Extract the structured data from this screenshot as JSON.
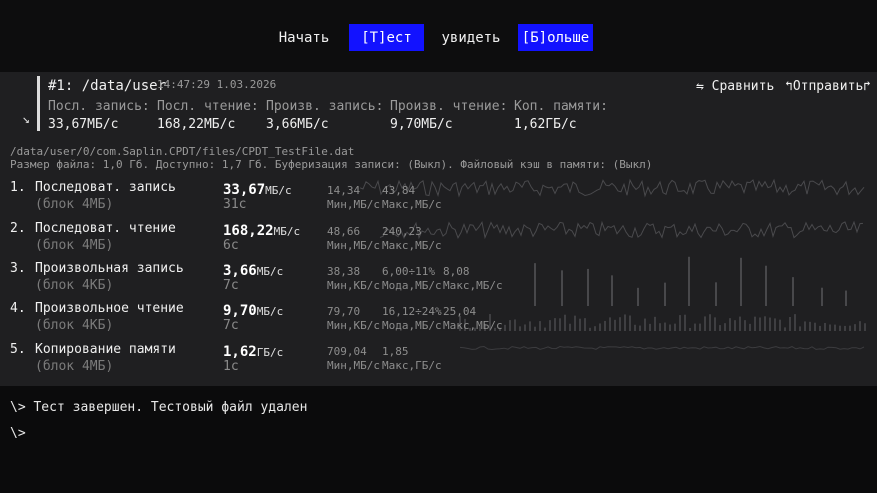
{
  "menu": {
    "start": "Начать",
    "test": "[Т]ест",
    "view": "увидеть",
    "more": "[Б]ольше"
  },
  "header": {
    "title": "#1: /data/user",
    "timestamp": "14:47:29 1.03.2026",
    "compare": "⇋ Сравнить",
    "send": "↰Отправить↱",
    "columns": [
      {
        "label": "Посл. запись:",
        "value": "33,67МБ/с"
      },
      {
        "label": "Посл. чтение:",
        "value": "168,22МБ/с"
      },
      {
        "label": "Произв. запись:",
        "value": "3,66МБ/с"
      },
      {
        "label": "Произв. чтение:",
        "value": "9,70МБ/с"
      },
      {
        "label": "Коп. памяти:",
        "value": "1,62ГБ/с"
      }
    ]
  },
  "file": {
    "path": "/data/user/0/com.Saplin.CPDT/files/CPDT_TestFile.dat",
    "info": "Размер файла: 1,0 Гб. Доступно: 1,7 Гб. Буферизация записи: (Выкл). Файловый кэш в памяти: (Выкл)"
  },
  "tests": [
    {
      "num": "1.",
      "name": "Последоват. запись",
      "block": "(блок 4МБ)",
      "value": "33,67",
      "unit": "МБ/с",
      "time": "31с",
      "stats": [
        {
          "v": "14,34",
          "l": "Мин,МБ/с"
        },
        {
          "v": "43,84",
          "l": "Макс,МБ/с"
        }
      ]
    },
    {
      "num": "2.",
      "name": "Последоват. чтение",
      "block": "(блок 4МБ)",
      "value": "168,22",
      "unit": "МБ/с",
      "time": "6с",
      "stats": [
        {
          "v": "48,66",
          "l": "Мин,МБ/с"
        },
        {
          "v": "240,23",
          "l": "Макс,МБ/с"
        }
      ]
    },
    {
      "num": "3.",
      "name": "Произвольная запись",
      "block": "(блок 4КБ)",
      "value": "3,66",
      "unit": "МБ/с",
      "time": "7с",
      "stats": [
        {
          "v": "38,38",
          "l": "Мин,КБ/с"
        },
        {
          "v": "6,00÷11%",
          "l": "Мода,МБ/с"
        },
        {
          "v": "8,08",
          "l": "Макс,МБ/с"
        }
      ]
    },
    {
      "num": "4.",
      "name": "Произвольное чтение",
      "block": "(блок 4КБ)",
      "value": "9,70",
      "unit": "МБ/с",
      "time": "7с",
      "stats": [
        {
          "v": "79,70",
          "l": "Мин,КБ/с"
        },
        {
          "v": "16,12÷24%",
          "l": "Мода,МБ/с"
        },
        {
          "v": "25,04",
          "l": "Макс,МБ/с"
        }
      ]
    },
    {
      "num": "5.",
      "name": "Копирование памяти",
      "block": "(блок 4МБ)",
      "value": "1,62",
      "unit": "ГБ/с",
      "time": "1с",
      "stats": [
        {
          "v": "709,04",
          "l": "Мин,МБ/с"
        },
        {
          "v": "1,85",
          "l": "Макс,ГБ/с"
        }
      ]
    }
  ],
  "console": {
    "line1": "\\> Тест завершен. Тестовый файл удален",
    "line2": "\\>"
  },
  "colors": {
    "accent": "#1212ff",
    "panel": "#1f1f21",
    "background": "#0b0b0c"
  }
}
